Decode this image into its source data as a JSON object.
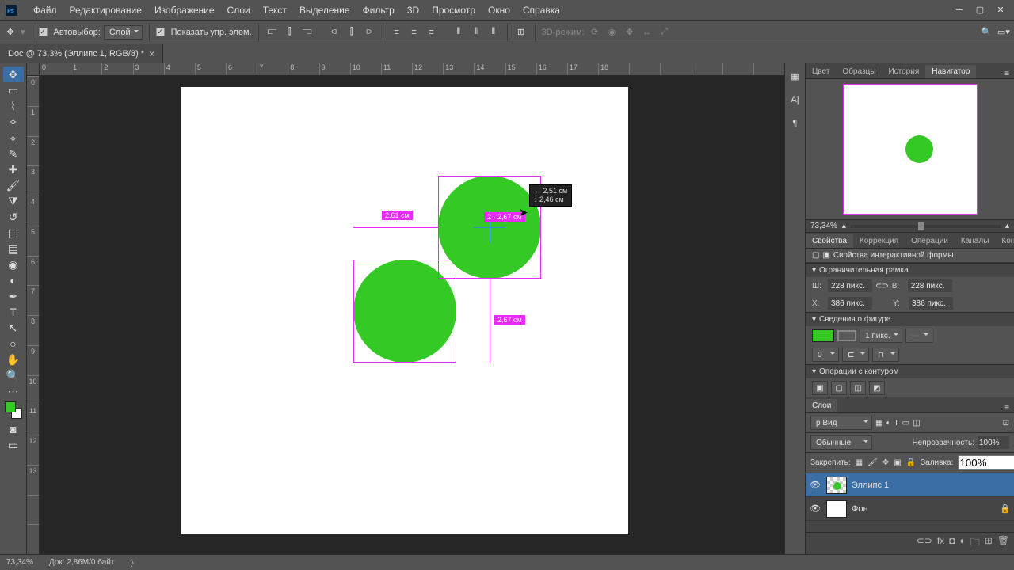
{
  "menu": [
    "Файл",
    "Редактирование",
    "Изображение",
    "Слои",
    "Текст",
    "Выделение",
    "Фильтр",
    "3D",
    "Просмотр",
    "Окно",
    "Справка"
  ],
  "options": {
    "autoselect_label": "Автовыбор:",
    "autoselect_value": "Слой",
    "show_controls_label": "Показать упр. элем.",
    "mode3d": "3D-режим:"
  },
  "doc": {
    "tab_title": "Doc @ 73,3% (Эллипс 1, RGB/8) *"
  },
  "ruler_h": [
    "0",
    "1",
    "2",
    "3",
    "4",
    "5",
    "6",
    "7",
    "8",
    "9",
    "10",
    "11",
    "12",
    "13",
    "14",
    "15",
    "16",
    "17",
    "18"
  ],
  "ruler_v": [
    "0",
    "1",
    "2",
    "3",
    "4",
    "5",
    "6",
    "7",
    "8",
    "9",
    "10",
    "11",
    "12",
    "13"
  ],
  "measurements": {
    "label_left": "2,61 см",
    "label_mid": "2 · 2,67 см",
    "label_bottom": "2,67 см",
    "tooltip_w": "↔  2,51 см",
    "tooltip_h": "↕  2,46 см"
  },
  "nav_tabs": [
    "Цвет",
    "Образцы",
    "История",
    "Навигатор"
  ],
  "nav_zoom": "73,34%",
  "prop_tabs": [
    "Свойства",
    "Коррекция",
    "Операции",
    "Каналы",
    "Контуры"
  ],
  "props": {
    "title": "Свойства интерактивной формы",
    "sec_box": "Ограничительная рамка",
    "w_lbl": "Ш:",
    "w_val": "228 пикс.",
    "h_lbl": "В:",
    "h_val": "228 пикс.",
    "x_lbl": "X:",
    "x_val": "386 пикс.",
    "y_lbl": "Y:",
    "y_val": "386 пикс.",
    "sec_shape": "Сведения о фигуре",
    "stroke_val": "1 пикс.",
    "radius_val": "0",
    "sec_path": "Операции с контуром"
  },
  "layers": {
    "title": "Слои",
    "kind": "р Вид",
    "blend": "Обычные",
    "opacity_lbl": "Непрозрачность:",
    "opacity_val": "100%",
    "lock_lbl": "Закрепить:",
    "fill_lbl": "Заливка:",
    "fill_val": "100%",
    "rows": [
      {
        "name": "Эллипс 1",
        "selected": true,
        "checker": true
      },
      {
        "name": "Фон",
        "selected": false,
        "locked": true
      }
    ]
  },
  "status": {
    "zoom": "73,34%",
    "docinfo": "Док: 2,86M/0 байт"
  },
  "colors": {
    "fg": "#34c924",
    "accent": "#e829ff"
  }
}
